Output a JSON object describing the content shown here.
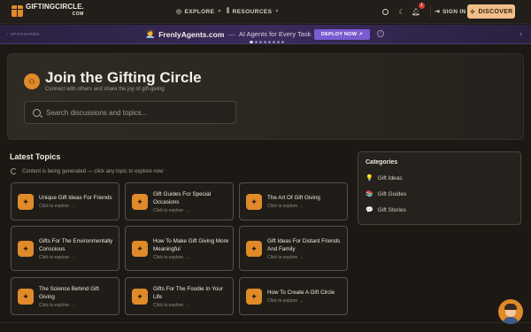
{
  "header": {
    "logo_main": "GIFTINGCIRCLE.",
    "logo_sub": "COM",
    "nav": [
      {
        "label": "EXPLORE",
        "icon": "compass-icon"
      },
      {
        "label": "RESOURCES",
        "icon": "library-icon"
      }
    ],
    "notification_count": "1",
    "sign_in_label": "SIGN IN",
    "discover_label": "DISCOVER"
  },
  "sponsor": {
    "label": "SPONSORED",
    "brand": "FrenlyAgents.com",
    "dash": "—",
    "tagline": "AI Agents for Every Task",
    "cta": "DEPLOY NOW",
    "cta_arrow": "↗",
    "info": "i",
    "dots": 8,
    "active_dot": 0
  },
  "hero": {
    "title": "Join the Gifting Circle",
    "subtitle": "Connect with others and share the joy of gift-giving",
    "search_placeholder": "Search discussions and topics..."
  },
  "latest": {
    "title": "Latest Topics",
    "status": "Content is being generated — click any topic to explore now",
    "explore_label": "Click to explore →",
    "topics": [
      "Unique Gift Ideas For Friends",
      "Gift Guides For Special Occasions",
      "The Art Of Gift Giving",
      "Gifts For The Environmentally Conscious",
      "How To Make Gift Giving More Meaningful",
      "Gift Ideas For Distant Friends And Family",
      "The Science Behind Gift Giving",
      "Gifts For The Foodie In Your Life",
      "How To Create A Gift Circle"
    ]
  },
  "categories": {
    "title": "Categories",
    "items": [
      {
        "label": "Gift Ideas",
        "icon": "lightbulb-icon"
      },
      {
        "label": "Gift Guides",
        "icon": "books-icon"
      },
      {
        "label": "Gift Stories",
        "icon": "speech-bubble-icon"
      }
    ]
  },
  "colors": {
    "accent": "#e08a2a",
    "discover_bg": "#f1c08a",
    "sponsor_cta": "#7a5bd0",
    "background": "#1c1915"
  }
}
